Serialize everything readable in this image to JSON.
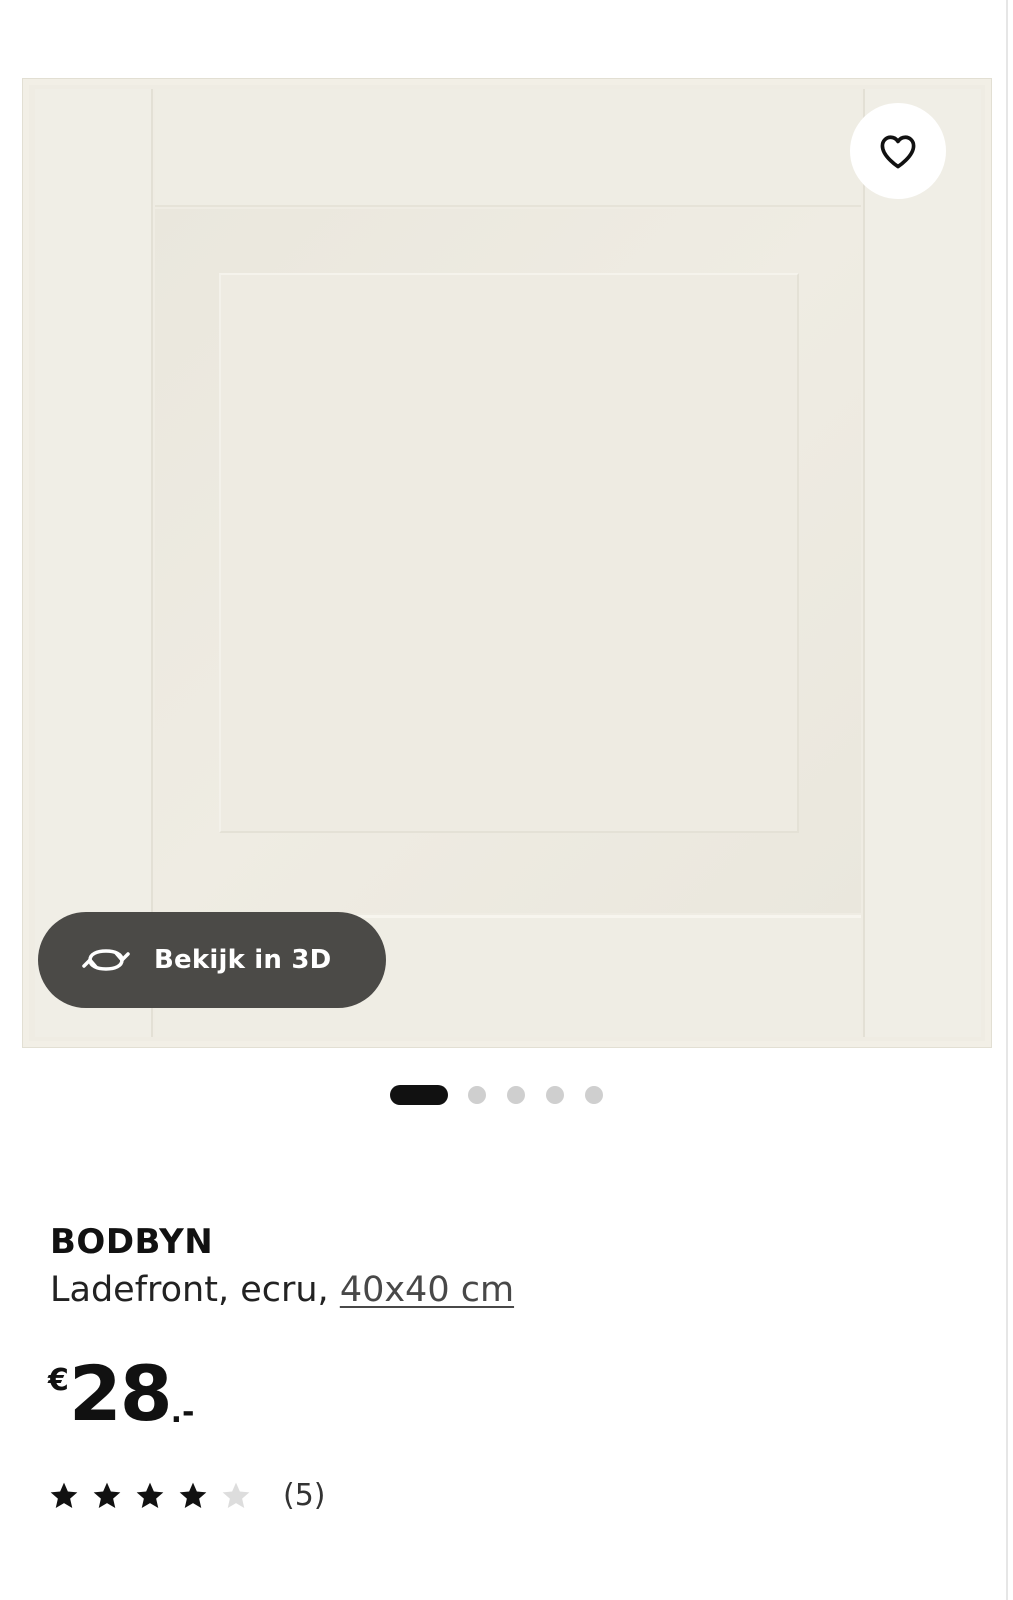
{
  "product": {
    "name": "BODBYN",
    "description": "Ladefront, ecru, ",
    "size_link": "40x40 cm",
    "price": {
      "currency": "€",
      "integer": "28",
      "decimal": ".-"
    },
    "rating": {
      "value": 4,
      "max": 5,
      "count_text": "(5)"
    }
  },
  "gallery": {
    "view_3d_label": "Bekijk in 3D",
    "favorite_icon": "heart-outline-icon",
    "rotate_icon": "rotate-3d-icon",
    "image_count": 5,
    "active_index": 0
  },
  "colors": {
    "door": "#efece3",
    "view3d_bg": "#4b4a47",
    "dot_active": "#111111",
    "dot_inactive": "#cfcfcf",
    "star_filled": "#111111",
    "star_empty": "#dddddd"
  }
}
